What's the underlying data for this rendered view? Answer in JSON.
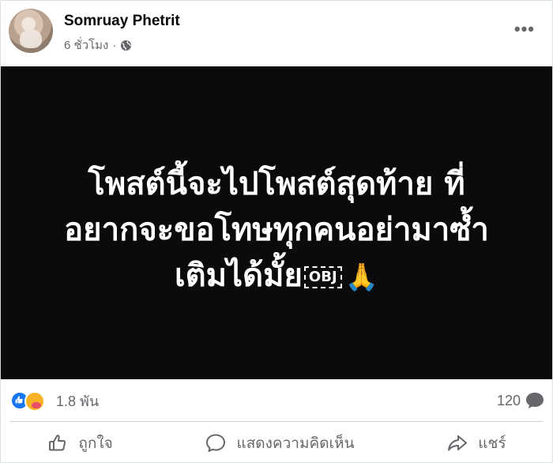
{
  "post": {
    "author": "Somruay Phetrit",
    "time": "6 ชั่วโมง",
    "separator": "·",
    "more": "•••",
    "text_lines": [
      "โพสต์นี้จะไปโพสต์สุดท้าย ที่",
      "อยากจะขอโทษทุกคนอย่ามาซ้ำ",
      "เติมได้มั้ย"
    ],
    "obj_marker": "OBJ",
    "emoji": "🙏"
  },
  "stats": {
    "reactions_count": "1.8 พัน",
    "comments_count": "120"
  },
  "actions": {
    "like": "ถูกใจ",
    "comment": "แสดงความคิดเห็น",
    "share": "แชร์"
  },
  "colors": {
    "accent": "#1877f2",
    "text_secondary": "#65676b",
    "image_bg": "#0b0b0b"
  }
}
